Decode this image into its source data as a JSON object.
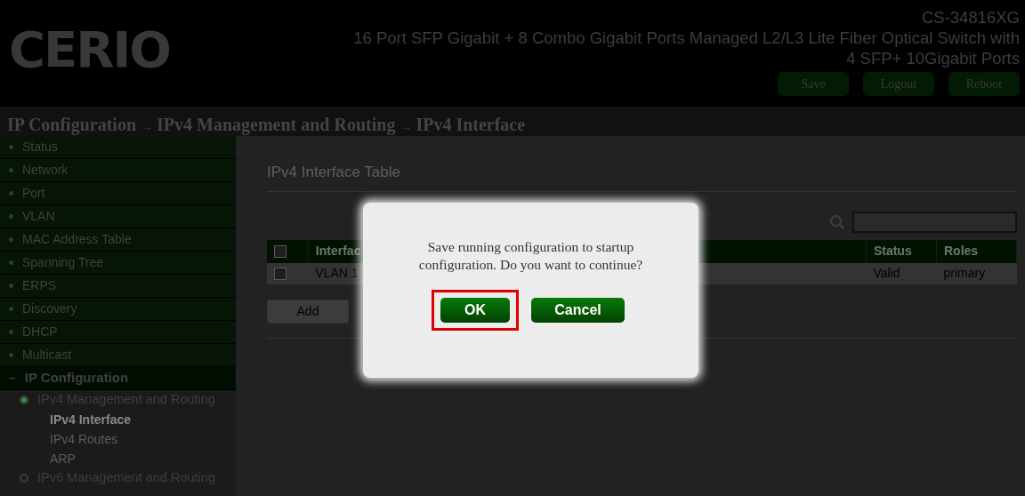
{
  "header": {
    "logo": "CERIO",
    "model": "CS-34816XG",
    "description_lines": [
      "16 Port SFP Gigabit + 8 Combo Gigabit Ports Managed L2/L3 Lite Fiber Optical Switch with",
      "4 SFP+ 10Gigabit Ports"
    ],
    "buttons": [
      "Save",
      "Logout",
      "Reboot"
    ]
  },
  "breadcrumb": {
    "items": [
      "IP Configuration",
      "IPv4 Management and Routing",
      "IPv4 Interface"
    ],
    "separator": "→"
  },
  "sidebar": {
    "items": [
      {
        "label": "Status",
        "expanded": false
      },
      {
        "label": "Network",
        "expanded": false
      },
      {
        "label": "Port",
        "expanded": false
      },
      {
        "label": "VLAN",
        "expanded": false
      },
      {
        "label": "MAC Address Table",
        "expanded": false
      },
      {
        "label": "Spanning Tree",
        "expanded": false
      },
      {
        "label": "ERPS",
        "expanded": false
      },
      {
        "label": "Discovery",
        "expanded": false
      },
      {
        "label": "DHCP",
        "expanded": false
      },
      {
        "label": "Multicast",
        "expanded": false
      },
      {
        "label": "IP Configuration",
        "expanded": true,
        "expand_sign": "–",
        "children": [
          {
            "label": "IPv4 Management and Routing",
            "expanded": true,
            "children": [
              {
                "label": "IPv4 Interface",
                "selected": true
              },
              {
                "label": "IPv4 Routes",
                "selected": false
              },
              {
                "label": "ARP",
                "selected": false
              }
            ]
          },
          {
            "label": "IPv6 Management and Routing",
            "expanded": false
          }
        ]
      }
    ]
  },
  "main": {
    "title": "IPv4 Interface Table",
    "table": {
      "columns": [
        "Interfac",
        "",
        "Status",
        "Roles"
      ],
      "rows": [
        {
          "checked": false,
          "cells": [
            "VLAN 1",
            "",
            "Valid",
            "primary"
          ]
        }
      ],
      "header_checked": false
    },
    "add_button": "Add"
  },
  "dialog": {
    "message": "Save running configuration to startup configuration. Do you want to continue?",
    "buttons": [
      {
        "label": "OK",
        "highlighted": true
      },
      {
        "label": "Cancel",
        "highlighted": false
      }
    ]
  }
}
